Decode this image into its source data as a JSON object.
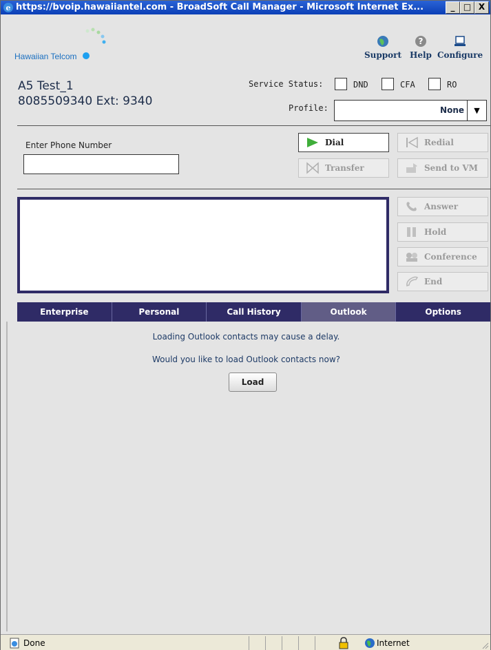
{
  "window": {
    "title": "https://bvoip.hawaiiantel.com - BroadSoft Call Manager - Microsoft Internet Ex...",
    "min_label": "_",
    "max_label": "□",
    "close_label": "X"
  },
  "header": {
    "logo_text": "Hawaiian Telcom",
    "tools": [
      {
        "label": "Support",
        "icon": "globe-icon"
      },
      {
        "label": "Help",
        "icon": "help-icon"
      },
      {
        "label": "Configure",
        "icon": "monitor-icon"
      }
    ]
  },
  "user": {
    "name": "A5 Test_1",
    "ext": "8085509340 Ext: 9340"
  },
  "service_status": {
    "label": "Service Status:",
    "options": [
      {
        "label": "DND",
        "checked": false
      },
      {
        "label": "CFA",
        "checked": false
      },
      {
        "label": "RO",
        "checked": false
      }
    ]
  },
  "profile": {
    "label": "Profile:",
    "value": "None",
    "arrow": "▼"
  },
  "dial": {
    "label": "Enter Phone Number",
    "value": ""
  },
  "buttons": {
    "dial": "Dial",
    "redial": "Redial",
    "transfer": "Transfer",
    "send_to_vm": "Send to VM",
    "answer": "Answer",
    "hold": "Hold",
    "conference": "Conference",
    "end": "End"
  },
  "tabs": [
    {
      "label": "Enterprise",
      "selected": false
    },
    {
      "label": "Personal",
      "selected": false
    },
    {
      "label": "Call History",
      "selected": false
    },
    {
      "label": "Outlook",
      "selected": true
    },
    {
      "label": "Options",
      "selected": false
    }
  ],
  "outlook": {
    "line1": "Loading Outlook contacts may cause a delay.",
    "line2": "Would you like to load Outlook contacts now?",
    "load_label": "Load"
  },
  "statusbar": {
    "status": "Done",
    "zone": "Internet"
  },
  "colors": {
    "title_bar": "#0b3fb6",
    "tab_bar": "#2f2b66",
    "tab_selected": "#615d86",
    "text_blue": "#1d3a66",
    "dial_green": "#3fae3a"
  }
}
